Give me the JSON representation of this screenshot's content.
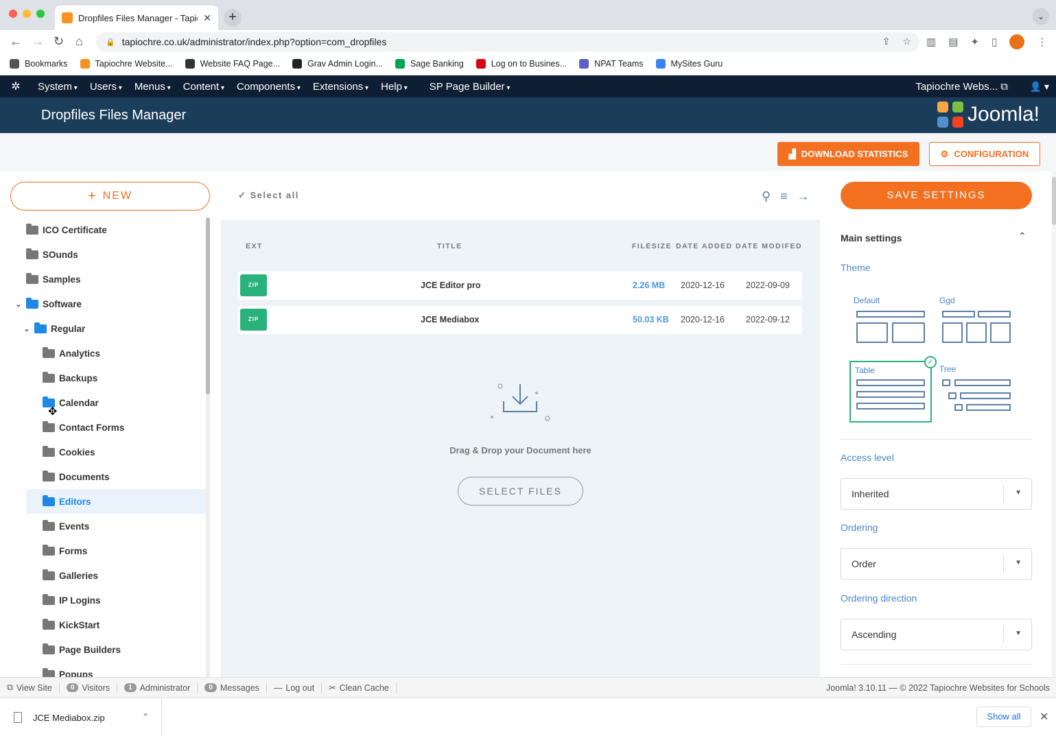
{
  "browser": {
    "tab_title": "Dropfiles Files Manager - Tapiochre",
    "url": "tapiochre.co.uk/administrator/index.php?option=com_dropfiles",
    "bookmarks": [
      {
        "label": "Bookmarks",
        "color": "#555555"
      },
      {
        "label": "Tapiochre Website...",
        "color": "#f7931e"
      },
      {
        "label": "Website FAQ Page...",
        "color": "#333333"
      },
      {
        "label": "Grav Admin Login...",
        "color": "#222222"
      },
      {
        "label": "Sage Banking",
        "color": "#00a651"
      },
      {
        "label": "Log on to Busines...",
        "color": "#db0011"
      },
      {
        "label": "NPAT Teams",
        "color": "#5b5fc7"
      },
      {
        "label": "MySites Guru",
        "color": "#3b82f6"
      }
    ]
  },
  "joomla_menu": {
    "items": [
      "System",
      "Users",
      "Menus",
      "Content",
      "Components",
      "Extensions",
      "Help",
      "SP Page Builder"
    ],
    "site_link": "Tapiochre Webs..."
  },
  "header": {
    "title": "Dropfiles Files Manager",
    "brand": "Joomla!"
  },
  "actions": {
    "download_statistics": "DOWNLOAD STATISTICS",
    "configuration": "CONFIGURATION"
  },
  "sidebar": {
    "new_label": "NEW",
    "tree": [
      {
        "label": "ICO Certificate",
        "level": 0,
        "caret": "",
        "blue": false,
        "active": false
      },
      {
        "label": "SOunds",
        "level": 0,
        "caret": "",
        "blue": false,
        "active": false
      },
      {
        "label": "Samples",
        "level": 0,
        "caret": "",
        "blue": false,
        "active": false
      },
      {
        "label": "Software",
        "level": 0,
        "caret": "down",
        "blue": true,
        "active": false
      },
      {
        "label": "Regular",
        "level": 1,
        "caret": "down",
        "blue": true,
        "active": false
      },
      {
        "label": "Analytics",
        "level": 2,
        "caret": "",
        "blue": false,
        "active": false
      },
      {
        "label": "Backups",
        "level": 2,
        "caret": "",
        "blue": false,
        "active": false
      },
      {
        "label": "Calendar",
        "level": 2,
        "caret": "",
        "blue": true,
        "active": false
      },
      {
        "label": "Contact Forms",
        "level": 2,
        "caret": "",
        "blue": false,
        "active": false
      },
      {
        "label": "Cookies",
        "level": 2,
        "caret": "",
        "blue": false,
        "active": false
      },
      {
        "label": "Documents",
        "level": 2,
        "caret": "",
        "blue": false,
        "active": false
      },
      {
        "label": "Editors",
        "level": 2,
        "caret": "",
        "blue": true,
        "active": true
      },
      {
        "label": "Events",
        "level": 2,
        "caret": "",
        "blue": false,
        "active": false
      },
      {
        "label": "Forms",
        "level": 2,
        "caret": "",
        "blue": false,
        "active": false
      },
      {
        "label": "Galleries",
        "level": 2,
        "caret": "",
        "blue": false,
        "active": false
      },
      {
        "label": "IP Logins",
        "level": 2,
        "caret": "",
        "blue": false,
        "active": false
      },
      {
        "label": "KickStart",
        "level": 2,
        "caret": "",
        "blue": false,
        "active": false
      },
      {
        "label": "Page Builders",
        "level": 2,
        "caret": "",
        "blue": false,
        "active": false
      },
      {
        "label": "Popups",
        "level": 2,
        "caret": "",
        "blue": false,
        "active": false
      }
    ]
  },
  "files": {
    "select_all": "Select all",
    "columns": {
      "ext": "EXT",
      "title": "TITLE",
      "filesize": "FILESIZE",
      "date_added": "DATE ADDED",
      "date_modified": "DATE MODIFED"
    },
    "rows": [
      {
        "ext": "ZIP",
        "title": "JCE Editor pro",
        "size": "2.26 MB",
        "added": "2020-12-16",
        "modified": "2022-09-09"
      },
      {
        "ext": "ZIP",
        "title": "JCE Mediabox",
        "size": "50.03 KB",
        "added": "2020-12-16",
        "modified": "2022-09-12"
      }
    ],
    "drop_text": "Drag & Drop your Document here",
    "select_files": "SELECT FILES"
  },
  "settings": {
    "save_label": "SAVE SETTINGS",
    "section_title": "Main settings",
    "theme_label": "Theme",
    "themes": [
      {
        "name": "Default",
        "selected": false
      },
      {
        "name": "Ggd",
        "selected": false
      },
      {
        "name": "Table",
        "selected": true
      },
      {
        "name": "Tree",
        "selected": false
      }
    ],
    "access_level_label": "Access level",
    "access_level_value": "Inherited",
    "ordering_label": "Ordering",
    "ordering_value": "Order",
    "ordering_direction_label": "Ordering direction",
    "ordering_direction_value": "Ascending"
  },
  "statusbar": {
    "view_site": "View Site",
    "visitors_count": "0",
    "visitors": "Visitors",
    "admin_count": "1",
    "administrator": "Administrator",
    "messages_count": "0",
    "messages": "Messages",
    "logout": "Log out",
    "clean_cache": "Clean Cache",
    "copyright": "Joomla! 3.10.11  —  © 2022 Tapiochre Websites for Schools"
  },
  "downloads": {
    "file": "JCE Mediabox.zip",
    "show_all": "Show all"
  },
  "colors": {
    "accent": "#f37021",
    "joomla_nav": "#0f1f33",
    "joomla_header": "#1c3d5a",
    "zip_badge": "#2ab27b",
    "link_blue": "#4a86c8"
  }
}
